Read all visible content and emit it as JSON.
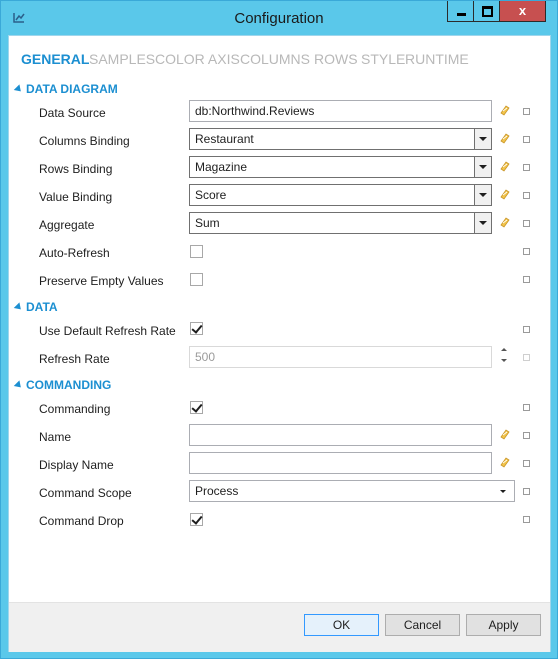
{
  "window": {
    "title": "Configuration",
    "close_glyph": "x"
  },
  "tabs": [
    "GENERAL",
    "SAMPLES",
    "COLOR AXIS",
    "COLUMNS",
    "ROWS",
    "STYLE",
    "RUNTIME"
  ],
  "active_tab": "GENERAL",
  "sections": {
    "data_diagram": "DATA DIAGRAM",
    "data": "DATA",
    "commanding": "COMMANDING"
  },
  "fields": {
    "data_source": {
      "label": "Data Source",
      "value": "db:Northwind.Reviews"
    },
    "columns_binding": {
      "label": "Columns Binding",
      "value": "Restaurant"
    },
    "rows_binding": {
      "label": "Rows Binding",
      "value": "Magazine"
    },
    "value_binding": {
      "label": "Value Binding",
      "value": "Score"
    },
    "aggregate": {
      "label": "Aggregate",
      "value": "Sum"
    },
    "auto_refresh": {
      "label": "Auto-Refresh",
      "checked": false
    },
    "preserve_empty": {
      "label": "Preserve Empty Values",
      "checked": false
    },
    "use_default_refresh": {
      "label": "Use Default Refresh Rate",
      "checked": true
    },
    "refresh_rate": {
      "label": "Refresh Rate",
      "value": "500"
    },
    "commanding": {
      "label": "Commanding",
      "checked": true
    },
    "name": {
      "label": "Name",
      "value": ""
    },
    "display_name": {
      "label": "Display Name",
      "value": ""
    },
    "command_scope": {
      "label": "Command Scope",
      "value": "Process"
    },
    "command_drop": {
      "label": "Command Drop",
      "checked": true
    }
  },
  "buttons": {
    "ok": "OK",
    "cancel": "Cancel",
    "apply": "Apply"
  },
  "icons": {
    "binding": "binding-icon",
    "app": "app-icon"
  },
  "colors": {
    "titlebar": "#5ac8ea",
    "accent": "#1c8fd1",
    "close": "#c75050"
  }
}
